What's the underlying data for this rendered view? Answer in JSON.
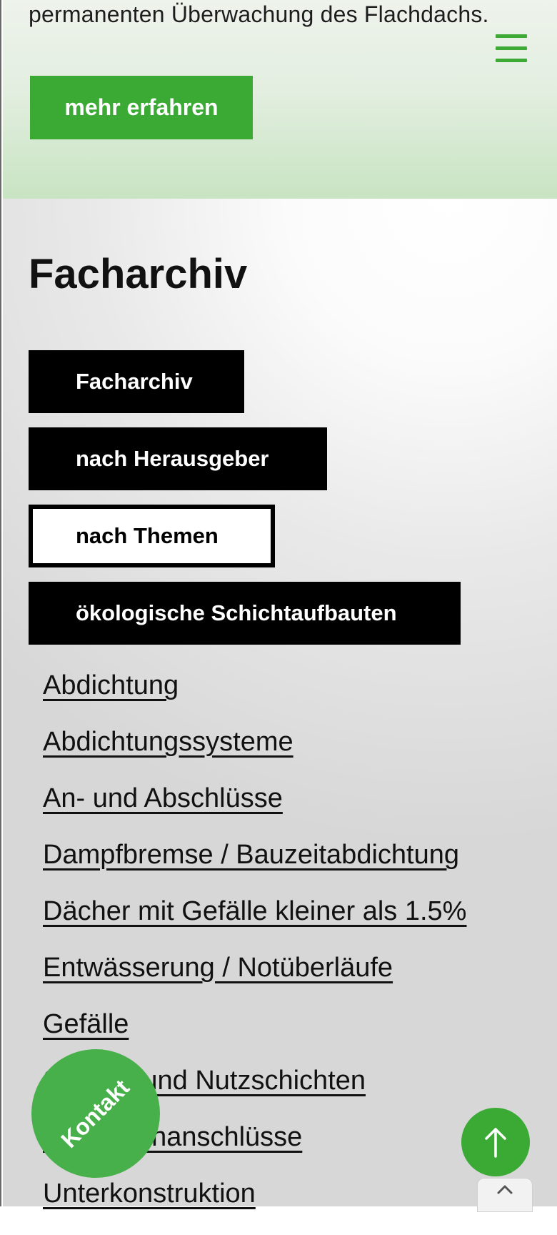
{
  "hero": {
    "text": "permanenten Überwachung des Flachdachs.",
    "button_label": "mehr erfahren"
  },
  "archive": {
    "title": "Facharchiv",
    "tabs": [
      {
        "label": "Facharchiv",
        "active": false
      },
      {
        "label": "nach Herausgeber",
        "active": false
      },
      {
        "label": "nach Themen",
        "active": true
      },
      {
        "label": "ökologische Schichtaufbauten",
        "active": false
      }
    ],
    "topics": [
      "Abdichtung",
      "Abdichtungssysteme",
      "An- und Abschlüsse",
      "Dampfbremse / Bauzeitabdichtung",
      "Dächer mit Gefälle kleiner als 1.5%",
      "Entwässerung / Notüberläufe",
      "Gefälle",
      "Schutz- und Nutzschichten",
      "Schwellenanschlüsse",
      "Unterkonstruktion"
    ]
  },
  "floating": {
    "contact_label": "Kontakt",
    "to_top_icon": "arrow-up-icon",
    "chevron_icon": "chevron-up-icon"
  },
  "colors": {
    "accent_green": "#3aaa35",
    "tab_dark": "#000000"
  }
}
